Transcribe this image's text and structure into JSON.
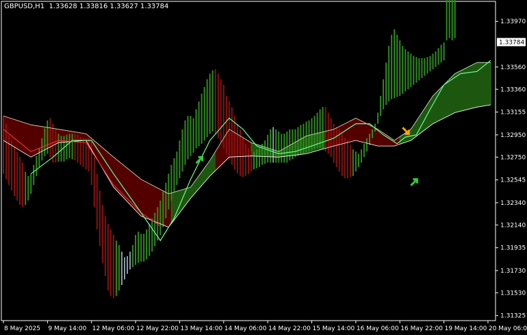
{
  "header": {
    "symbol": "GBPUSD,H1",
    "ohlc": "1.33628 1.33816 1.33627 1.33784"
  },
  "colors": {
    "background": "#000000",
    "frame": "#ffffff",
    "bull_band": "#2d7a1a",
    "bull_band_fill": "#1f5c10",
    "bear_band": "#8a0a0a",
    "bear_band_fill": "#5a0000",
    "bull_bar": "#2e8b1f",
    "bear_bar": "#8b1010",
    "neutral_bar": "#8a9aa8",
    "fast_line": "#66ff99",
    "slow_line": "#ffffff",
    "bear_line": "#ff3333",
    "arrow_up": "#33cc33",
    "arrow_down": "#ffa500",
    "price_box": "#ffffff"
  },
  "chart_data": {
    "type": "line",
    "title": "GBPUSD,H1",
    "ylim": [
      1.3128,
      1.3415
    ],
    "current_price": "1.33784",
    "y_ticks": [
      "1.33970",
      "1.33560",
      "1.33360",
      "1.33155",
      "1.32950",
      "1.32750",
      "1.32545",
      "1.32340",
      "1.32140",
      "1.31935",
      "1.31730",
      "1.31530",
      "1.31325"
    ],
    "y_tick_values": [
      1.3397,
      1.3356,
      1.3336,
      1.33155,
      1.3295,
      1.3275,
      1.32545,
      1.3234,
      1.3214,
      1.31935,
      1.3173,
      1.3153,
      1.31325
    ],
    "x_ticks": [
      "8 May 2025",
      "9 May 14:00",
      "12 May 06:00",
      "12 May 22:00",
      "13 May 14:00",
      "14 May 06:00",
      "14 May 22:00",
      "15 May 14:00",
      "16 May 06:00",
      "16 May 22:00",
      "19 May 14:00",
      "20 May 06:00"
    ],
    "x_tick_index": [
      0,
      16,
      32,
      48,
      64,
      80,
      96,
      112,
      128,
      144,
      160,
      176
    ],
    "bar_count": 178,
    "series": [
      {
        "name": "",
        "role": "upper_band",
        "x": [
          0,
          10,
          20,
          30,
          40,
          50,
          60,
          68,
          75,
          82,
          90,
          100,
          110,
          120,
          128,
          136,
          142,
          148,
          156,
          164,
          172,
          177
        ],
        "values": [
          1.3312,
          1.3304,
          1.33,
          1.3296,
          1.3275,
          1.3255,
          1.3242,
          1.3248,
          1.3272,
          1.33,
          1.3288,
          1.328,
          1.3294,
          1.33,
          1.331,
          1.33,
          1.329,
          1.33,
          1.333,
          1.335,
          1.336,
          1.336
        ]
      },
      {
        "name": "",
        "role": "lower_band",
        "x": [
          0,
          10,
          20,
          30,
          40,
          50,
          60,
          68,
          75,
          82,
          90,
          100,
          110,
          120,
          128,
          136,
          142,
          148,
          156,
          164,
          172,
          177
        ],
        "values": [
          1.329,
          1.3275,
          1.3288,
          1.329,
          1.3248,
          1.3222,
          1.3212,
          1.3238,
          1.3258,
          1.3275,
          1.3276,
          1.3275,
          1.3278,
          1.3285,
          1.329,
          1.3285,
          1.3285,
          1.329,
          1.3305,
          1.3315,
          1.332,
          1.3322
        ]
      },
      {
        "name": "",
        "role": "fast_line",
        "x": [
          10,
          18,
          25,
          32,
          40,
          50,
          57,
          62,
          68,
          75,
          82,
          87,
          92,
          100,
          106,
          112,
          120,
          128,
          133,
          138,
          143,
          146,
          150,
          155,
          160,
          166,
          172,
          177
        ],
        "values": [
          1.326,
          1.3275,
          1.329,
          1.329,
          1.326,
          1.3225,
          1.32,
          1.322,
          1.3255,
          1.329,
          1.331,
          1.33,
          1.3285,
          1.3278,
          1.328,
          1.3285,
          1.3292,
          1.3305,
          1.3305,
          1.3295,
          1.3287,
          1.3293,
          1.3295,
          1.3318,
          1.334,
          1.335,
          1.3352,
          1.3362
        ]
      },
      {
        "name": "",
        "role": "bear_line",
        "x": [
          0,
          10,
          20,
          30,
          40,
          50,
          57
        ],
        "values": [
          1.33,
          1.328,
          1.329,
          1.3288,
          1.325,
          1.3225,
          1.3213
        ]
      }
    ],
    "bars": {
      "high": [
        1.3312,
        1.3305,
        1.3295,
        1.329,
        1.3285,
        1.328,
        1.3275,
        1.327,
        1.3262,
        1.3258,
        1.326,
        1.3268,
        1.3276,
        1.3283,
        1.3292,
        1.3301,
        1.3308,
        1.331,
        1.3305,
        1.33,
        1.3296,
        1.3294,
        1.3294,
        1.3295,
        1.3296,
        1.3296,
        1.3296,
        1.3295,
        1.3293,
        1.3292,
        1.3292,
        1.3292,
        1.329,
        1.3275,
        1.326,
        1.3245,
        1.3232,
        1.3222,
        1.3215,
        1.321,
        1.3205,
        1.32,
        1.3196,
        1.319,
        1.3185,
        1.3186,
        1.319,
        1.3196,
        1.3205,
        1.3208,
        1.3206,
        1.3206,
        1.321,
        1.3215,
        1.322,
        1.3225,
        1.323,
        1.3236,
        1.3244,
        1.3252,
        1.326,
        1.3268,
        1.3274,
        1.328,
        1.329,
        1.33,
        1.3308,
        1.3312,
        1.3312,
        1.331,
        1.3318,
        1.3325,
        1.3332,
        1.3338,
        1.3345,
        1.335,
        1.3353,
        1.3354,
        1.335,
        1.3345,
        1.334,
        1.333,
        1.3325,
        1.332,
        1.3312,
        1.3305,
        1.33,
        1.3292,
        1.3287,
        1.3283,
        1.328,
        1.328,
        1.3282,
        1.3284,
        1.3287,
        1.329,
        1.3295,
        1.33,
        1.3302,
        1.33,
        1.3298,
        1.3296,
        1.3296,
        1.3298,
        1.33,
        1.33,
        1.33,
        1.3302,
        1.3304,
        1.3305,
        1.3307,
        1.3308,
        1.331,
        1.3312,
        1.3315,
        1.3318,
        1.332,
        1.332,
        1.3315,
        1.331,
        1.3305,
        1.3302,
        1.33,
        1.3296,
        1.3292,
        1.329,
        1.3286,
        1.3282,
        1.328,
        1.3278,
        1.3282,
        1.3287,
        1.3292,
        1.3296,
        1.33,
        1.3305,
        1.3315,
        1.333,
        1.3345,
        1.336,
        1.3375,
        1.3385,
        1.339,
        1.3385,
        1.338,
        1.3375,
        1.3372,
        1.337,
        1.3368,
        1.3366,
        1.3365,
        1.3364,
        1.3364,
        1.3364,
        1.3365,
        1.3366,
        1.3368,
        1.337,
        1.3373,
        1.3376,
        1.3378,
        1.338,
        1.3382,
        1.338,
        1.3382
      ],
      "low": [
        1.326,
        1.3255,
        1.325,
        1.3245,
        1.324,
        1.3236,
        1.3232,
        1.323,
        1.3232,
        1.3236,
        1.3242,
        1.325,
        1.3258,
        1.3266,
        1.3272,
        1.3276,
        1.3278,
        1.3275,
        1.327,
        1.327,
        1.3271,
        1.3271,
        1.3271,
        1.3273,
        1.3274,
        1.3273,
        1.3272,
        1.327,
        1.3268,
        1.3266,
        1.3264,
        1.3262,
        1.325,
        1.323,
        1.321,
        1.3195,
        1.318,
        1.3168,
        1.3155,
        1.315,
        1.3148,
        1.315,
        1.3155,
        1.316,
        1.3165,
        1.317,
        1.3174,
        1.3176,
        1.3178,
        1.318,
        1.3181,
        1.3181,
        1.3183,
        1.3186,
        1.319,
        1.3195,
        1.32,
        1.3205,
        1.3212,
        1.322,
        1.3228,
        1.3236,
        1.3244,
        1.325,
        1.3256,
        1.3262,
        1.3268,
        1.3273,
        1.3276,
        1.3279,
        1.3283,
        1.3285,
        1.3287,
        1.329,
        1.3293,
        1.3296,
        1.3298,
        1.3296,
        1.3292,
        1.3288,
        1.3283,
        1.3278,
        1.3273,
        1.3268,
        1.3264,
        1.326,
        1.3258,
        1.3257,
        1.3258,
        1.326,
        1.3262,
        1.3264,
        1.3265,
        1.3266,
        1.3268,
        1.3269,
        1.327,
        1.327,
        1.327,
        1.327,
        1.327,
        1.327,
        1.327,
        1.327,
        1.3272,
        1.3273,
        1.3275,
        1.3276,
        1.3277,
        1.3278,
        1.3279,
        1.328,
        1.3281,
        1.3282,
        1.3283,
        1.3283,
        1.3282,
        1.328,
        1.3278,
        1.3275,
        1.327,
        1.3266,
        1.3262,
        1.3258,
        1.3256,
        1.3256,
        1.3257,
        1.3258,
        1.3262,
        1.3266,
        1.327,
        1.3275,
        1.328,
        1.3286,
        1.3292,
        1.3298,
        1.3305,
        1.3312,
        1.3318,
        1.3322,
        1.3325,
        1.3327,
        1.3328,
        1.3329,
        1.333,
        1.3332,
        1.3334,
        1.3336,
        1.3338,
        1.334,
        1.3342,
        1.3344,
        1.3346,
        1.3348,
        1.335,
        1.3352,
        1.3354,
        1.3356,
        1.3358,
        1.336,
        1.3362
      ],
      "dir": [
        "d",
        "d",
        "d",
        "d",
        "d",
        "d",
        "d",
        "d",
        "u",
        "u",
        "u",
        "u",
        "u",
        "u",
        "u",
        "u",
        "u",
        "d",
        "d",
        "d",
        "u",
        "u",
        "u",
        "u",
        "u",
        "u",
        "d",
        "d",
        "d",
        "d",
        "d",
        "d",
        "d",
        "d",
        "d",
        "d",
        "d",
        "d",
        "d",
        "d",
        "d",
        "u",
        "u",
        "n",
        "n",
        "n",
        "n",
        "u",
        "u",
        "u",
        "u",
        "u",
        "u",
        "u",
        "u",
        "u",
        "u",
        "u",
        "u",
        "u",
        "u",
        "u",
        "u",
        "u",
        "u",
        "u",
        "u",
        "u",
        "u",
        "u",
        "u",
        "u",
        "u",
        "u",
        "u",
        "u",
        "u",
        "d",
        "d",
        "d",
        "d",
        "d",
        "d",
        "d",
        "d",
        "d",
        "d",
        "d",
        "d",
        "d",
        "d",
        "u",
        "u",
        "u",
        "u",
        "u",
        "u",
        "u",
        "n",
        "u",
        "u",
        "u",
        "u",
        "u",
        "u",
        "u",
        "u",
        "u",
        "u",
        "u",
        "u",
        "u",
        "u",
        "u",
        "u",
        "u",
        "u",
        "d",
        "d",
        "d",
        "d",
        "d",
        "d",
        "d",
        "d",
        "d",
        "d",
        "u",
        "u",
        "u",
        "u",
        "u",
        "u",
        "u",
        "u",
        "u",
        "u",
        "u",
        "u",
        "u",
        "u",
        "u",
        "u",
        "u",
        "u",
        "u",
        "u",
        "u",
        "u",
        "u",
        "u",
        "u",
        "u",
        "u",
        "u",
        "u",
        "u",
        "u",
        "u",
        "u",
        "u",
        "u",
        "u",
        "u",
        "u",
        "u",
        "u",
        "u",
        "u",
        "u",
        "u",
        "u",
        "u",
        "u"
      ]
    },
    "arrows": [
      {
        "type": "up",
        "index": 71,
        "price": 1.3272
      },
      {
        "type": "down",
        "index": 146,
        "price": 1.3299
      },
      {
        "type": "up",
        "index": 149,
        "price": 1.3252
      }
    ]
  }
}
